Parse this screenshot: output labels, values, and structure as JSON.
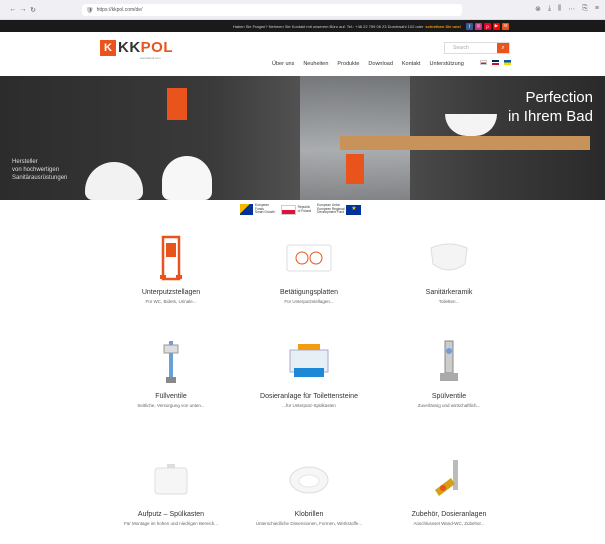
{
  "browser": {
    "url": "https://kkpol.com/de/",
    "nav_icons": [
      "←",
      "→",
      "↻"
    ],
    "right_icons": [
      "⊗",
      "⤓",
      "⫼",
      "⋯",
      "⎘",
      "≡"
    ]
  },
  "topbar": {
    "text": "Haben Sie Fragen? Nehmen Sie Kontakt mit unserem Büro auf. Tel.: +48 22 759 06 23 Durchwahl 102 oder",
    "link": "schreiben Sie uns!"
  },
  "logo": {
    "mark": "K",
    "text_kk": "KK",
    "text_pol": "POL",
    "sub": "www.kkpol.com"
  },
  "search": {
    "placeholder": "Search"
  },
  "nav": [
    "Über uns",
    "Neuheiten",
    "Produkte",
    "Download",
    "Kontakt",
    "Unterstützung"
  ],
  "hero": {
    "slogan_line1": "Perfection",
    "slogan_line2": "in Ihrem Bad",
    "claim_line1": "Hersteller",
    "claim_line2": "von hochwertigen",
    "claim_line3": "Sanitärausrüstungen"
  },
  "eu_logos": {
    "fe_line1": "European",
    "fe_line2": "Funds",
    "fe_line3": "Smart Growth",
    "pl_line1": "Republic",
    "pl_line2": "of Poland",
    "ue_line1": "European Union",
    "ue_line2": "European Regional",
    "ue_line3": "Development Fund"
  },
  "products": [
    {
      "title": "Unterputzstellagen",
      "desc": "Für WC, Bidets, Urinale..."
    },
    {
      "title": "Betätigungsplatten",
      "desc": "Für Unterputzstellagen..."
    },
    {
      "title": "Sanitärkeramik",
      "desc": "Toiletten..."
    },
    {
      "title": "Füllventile",
      "desc": "Seitliche, Versorgung von unten..."
    },
    {
      "title": "Dosieranlage für Toilettensteine",
      "desc": "...für Unterputz-Spülkasten"
    },
    {
      "title": "Spülventile",
      "desc": "Zuverlässig und wirtschaftlich..."
    },
    {
      "title": "Aufputz – Spülkasten",
      "desc": "Für Montage im hohen und niedrigen Bereich..."
    },
    {
      "title": "Klobrillen",
      "desc": "Unterschiedliche Dimensionen, Formen, Werkstoffe..."
    },
    {
      "title": "Zubehör, Dosieranlagen",
      "desc": "Anschlussset Wand-WC, Zubehör..."
    }
  ],
  "colors": {
    "brand": "#e8541c",
    "topbar": "#1a1a1a"
  }
}
